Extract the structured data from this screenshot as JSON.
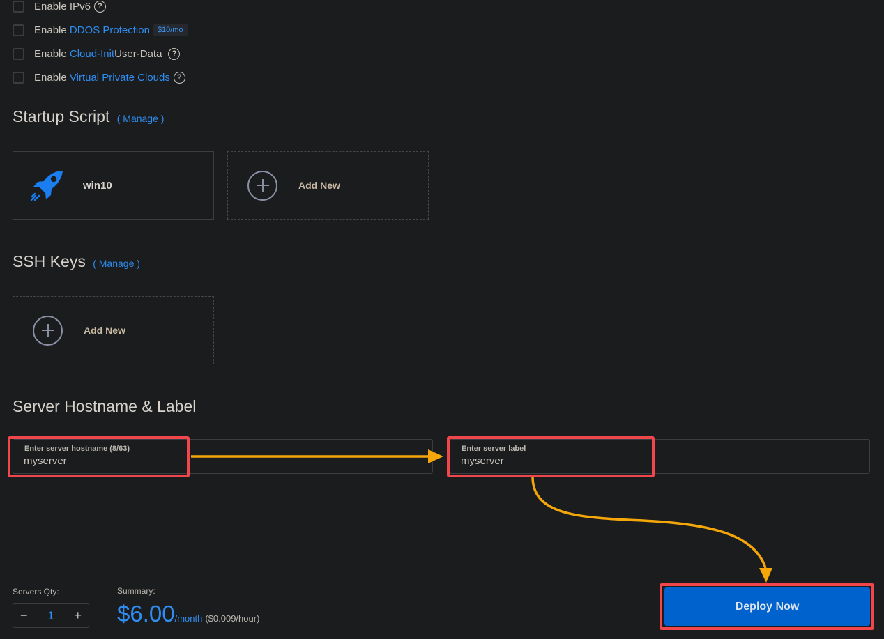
{
  "options": [
    {
      "prefix": "Enable ",
      "link": "",
      "text": "IPv6",
      "help": true,
      "badge": ""
    },
    {
      "prefix": "Enable ",
      "link": "DDOS Protection",
      "text": "",
      "help": false,
      "badge": "$10/mo"
    },
    {
      "prefix": "Enable ",
      "link": "Cloud-Init",
      "text": " User-Data",
      "help": true,
      "badge": ""
    },
    {
      "prefix": "Enable ",
      "link": "Virtual Private Clouds",
      "text": "",
      "help": true,
      "badge": ""
    }
  ],
  "help_glyph": "?",
  "startup_script": {
    "title": "Startup Script",
    "manage": "( Manage )",
    "script_name": "win10",
    "script_icon": "rocket-icon",
    "add_new": "Add New"
  },
  "ssh_keys": {
    "title": "SSH Keys",
    "manage": "( Manage )",
    "add_new": "Add New"
  },
  "hostname_label": {
    "title": "Server Hostname & Label",
    "hostname_label": "Enter server hostname (8/63)",
    "hostname_value": "myserver",
    "label_label": "Enter server label",
    "label_value": "myserver"
  },
  "footer": {
    "qty_label": "Servers Qty:",
    "qty_minus": "−",
    "qty_value": "1",
    "qty_plus": "+",
    "summary_label": "Summary:",
    "price": "$6.00",
    "per": "/month",
    "hourly": "($0.009/hour)",
    "deploy": "Deploy Now"
  },
  "annotation_colors": {
    "highlight": "#f2464d",
    "arrow": "#f5a70a",
    "accent": "#2f8cf0"
  }
}
